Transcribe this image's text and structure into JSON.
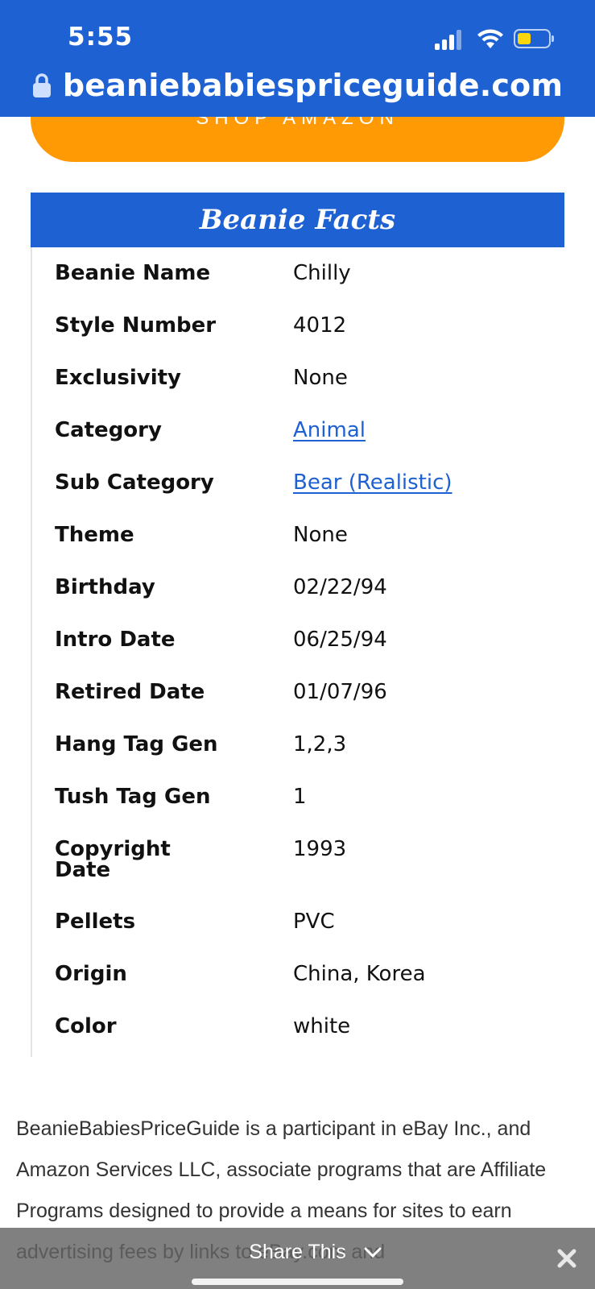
{
  "status_bar": {
    "time": "5:55"
  },
  "browser": {
    "url": "beaniebabiespriceguide.com"
  },
  "shop_button": {
    "label": "SHOP AMAZON"
  },
  "facts": {
    "title": "Beanie Facts",
    "rows": [
      {
        "label": "Beanie Name",
        "value": "Chilly"
      },
      {
        "label": "Style Number",
        "value": "4012"
      },
      {
        "label": "Exclusivity",
        "value": "None"
      },
      {
        "label": "Category",
        "value": "Animal"
      },
      {
        "label": "Sub Category",
        "value": "Bear (Realistic)"
      },
      {
        "label": "Theme",
        "value": "None"
      },
      {
        "label": "Birthday",
        "value": "02/22/94"
      },
      {
        "label": "Intro Date",
        "value": "06/25/94"
      },
      {
        "label": "Retired Date",
        "value": "01/07/96"
      },
      {
        "label": "Hang Tag Gen",
        "value": "1,2,3"
      },
      {
        "label": "Tush Tag Gen",
        "value": "1"
      },
      {
        "label": "Copyright Date",
        "value": "1993"
      },
      {
        "label": "Pellets",
        "value": "PVC"
      },
      {
        "label": "Origin",
        "value": "China, Korea"
      },
      {
        "label": "Color",
        "value": "white"
      }
    ]
  },
  "disclaimer": {
    "text": "BeanieBabiesPriceGuide is a participant in eBay Inc., and Amazon Services LLC, associate programs that are Affiliate Programs designed to provide a means for sites to earn advertising fees by links to eBay.com and"
  },
  "share_bar": {
    "label": "Share This"
  },
  "colors": {
    "brand_blue": "#1d61d3",
    "shop_orange": "#ff9a05",
    "battery_yellow": "#ffd60a"
  },
  "icons": [
    "lock-icon",
    "signal-icon",
    "wifi-icon",
    "battery-icon",
    "chevron-down-icon",
    "close-icon"
  ]
}
